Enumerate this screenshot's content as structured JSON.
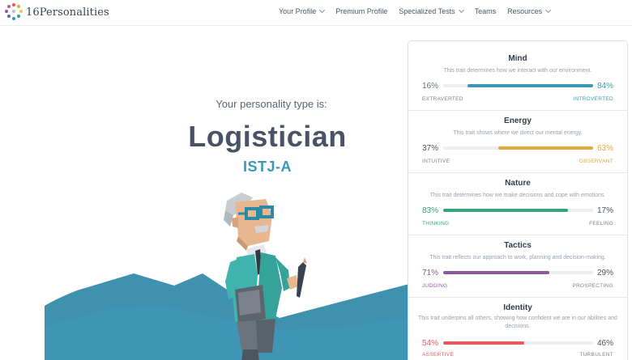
{
  "brand": {
    "name": "16Personalities"
  },
  "nav": [
    {
      "label": "Your Profile",
      "dropdown": true
    },
    {
      "label": "Premium Profile",
      "dropdown": false
    },
    {
      "label": "Specialized Tests",
      "dropdown": true
    },
    {
      "label": "Teams",
      "dropdown": false
    },
    {
      "label": "Resources",
      "dropdown": true
    }
  ],
  "hero": {
    "intro": "Your personality type is:",
    "type_name": "Logistician",
    "type_code": "ISTJ-A"
  },
  "traits": [
    {
      "title": "Mind",
      "description": "This trait determines how we interact with our environment.",
      "left_pct": "16%",
      "right_pct": "84%",
      "left_label": "EXTRAVERTED",
      "right_label": "INTROVERTED",
      "dominant": "right",
      "dominant_fraction": 0.84,
      "color": "#3a97b5"
    },
    {
      "title": "Energy",
      "description": "This trait shows where we direct our mental energy.",
      "left_pct": "37%",
      "right_pct": "63%",
      "left_label": "INTUITIVE",
      "right_label": "OBSERVANT",
      "dominant": "right",
      "dominant_fraction": 0.63,
      "color": "#e2a93a"
    },
    {
      "title": "Nature",
      "description": "This trait determines how we make decisions and cope with emotions.",
      "left_pct": "83%",
      "right_pct": "17%",
      "left_label": "THINKING",
      "right_label": "FEELING",
      "dominant": "left",
      "dominant_fraction": 0.83,
      "color": "#34a57c"
    },
    {
      "title": "Tactics",
      "description": "This trait reflects our approach to work, planning and decision-making.",
      "left_pct": "71%",
      "right_pct": "29%",
      "left_label": "JUDGING",
      "right_label": "PROSPECTING",
      "dominant": "left",
      "dominant_fraction": 0.71,
      "color": "#8a5a9b"
    },
    {
      "title": "Identity",
      "description": "This trait underpins all others, showing how confident we are in our abilities and decisions.",
      "left_pct": "54%",
      "right_pct": "46%",
      "left_label": "ASSERTIVE",
      "right_label": "TURBULENT",
      "dominant": "left",
      "dominant_fraction": 0.54,
      "color": "#e55b5b"
    }
  ]
}
